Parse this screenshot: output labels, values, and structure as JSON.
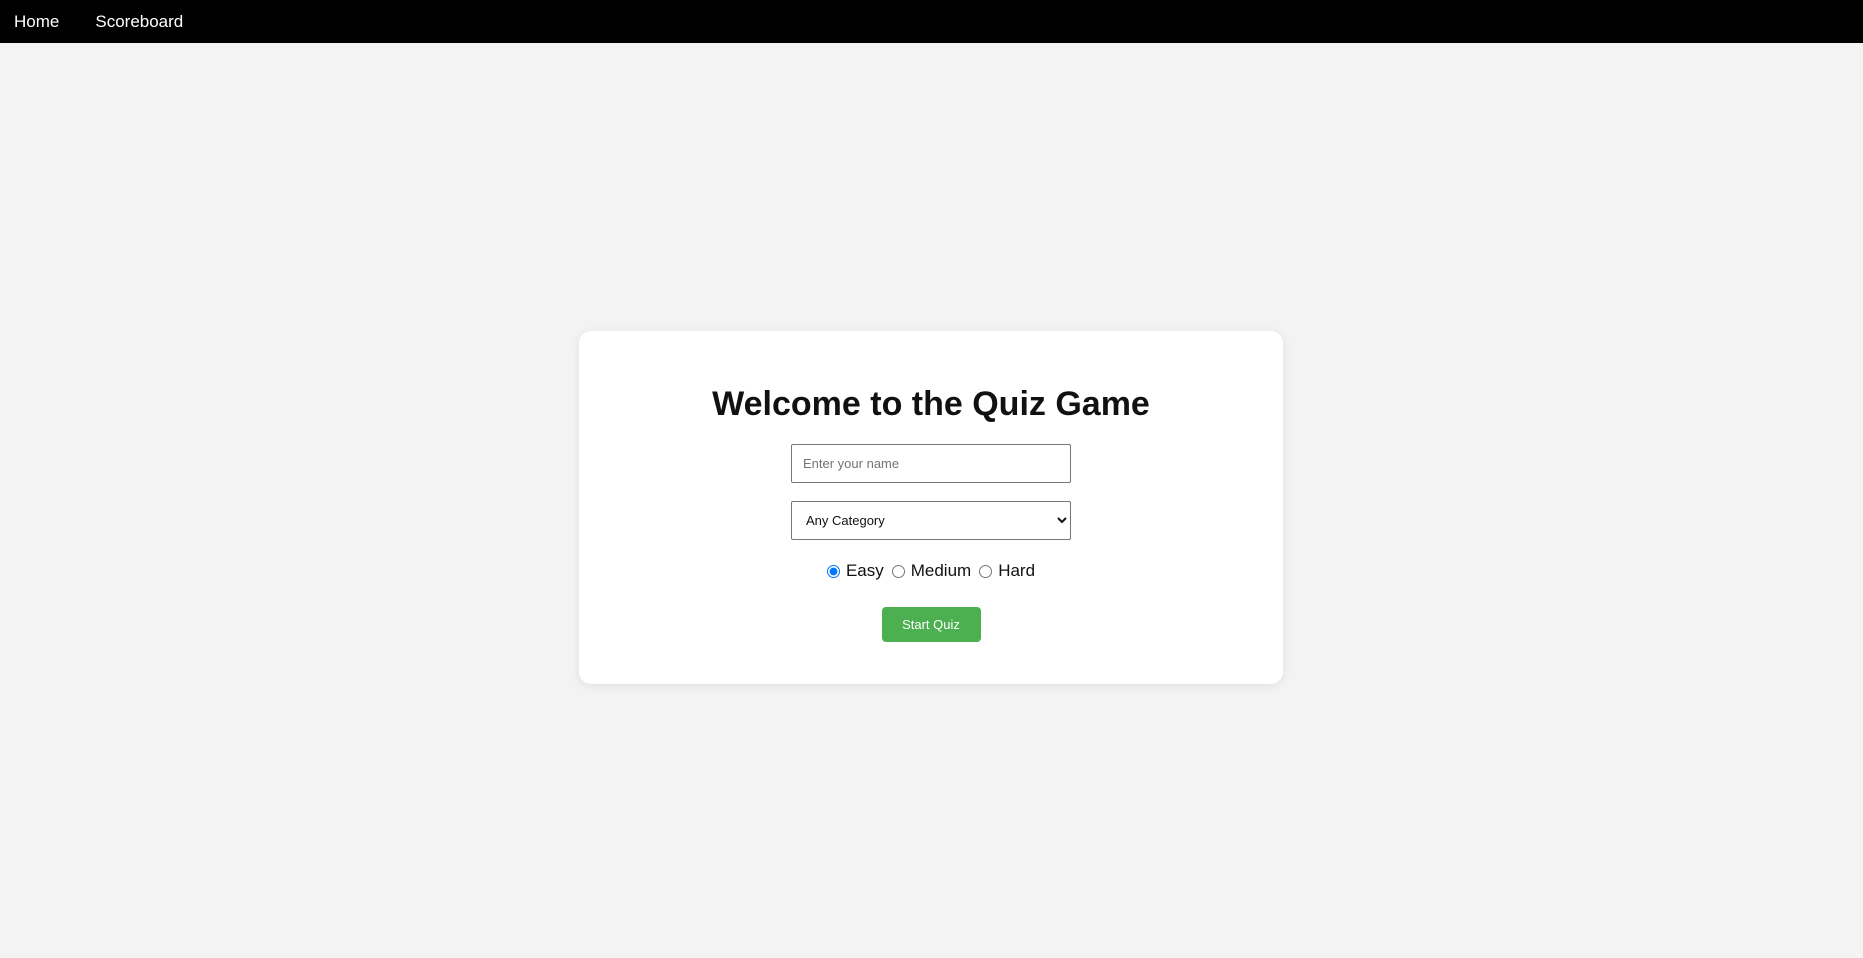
{
  "nav": {
    "items": [
      {
        "label": "Home"
      },
      {
        "label": "Scoreboard"
      }
    ]
  },
  "card": {
    "title": "Welcome to the Quiz Game",
    "name_input": {
      "placeholder": "Enter your name",
      "value": ""
    },
    "category_select": {
      "selected": "Any Category"
    },
    "difficulty": {
      "options": [
        {
          "label": "Easy",
          "checked": true
        },
        {
          "label": "Medium",
          "checked": false
        },
        {
          "label": "Hard",
          "checked": false
        }
      ]
    },
    "start_button_label": "Start Quiz"
  },
  "colors": {
    "navbar_bg": "#000000",
    "page_bg": "#f3f3f3",
    "card_bg": "#ffffff",
    "start_button_bg": "#4caf50"
  }
}
